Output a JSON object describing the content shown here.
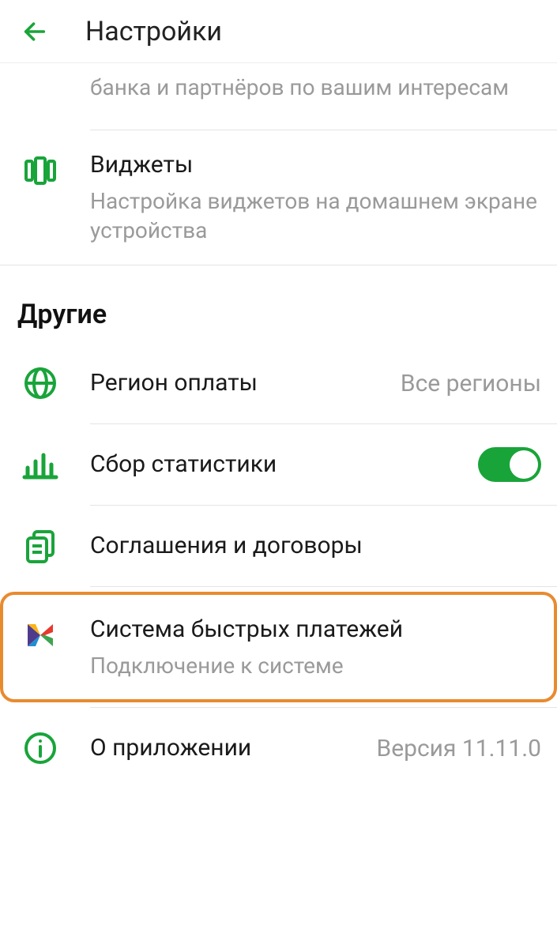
{
  "header": {
    "title": "Настройки"
  },
  "items": {
    "partial": {
      "subtitle": "банка и партнёров по вашим интересам"
    },
    "widgets": {
      "title": "Виджеты",
      "subtitle": "Настройка виджетов на домашнем экране устройства"
    }
  },
  "section_other": "Другие",
  "other": {
    "region": {
      "title": "Регион оплаты",
      "value": "Все регионы"
    },
    "stats": {
      "title": "Сбор статистики",
      "enabled": true
    },
    "agreements": {
      "title": "Соглашения и договоры"
    },
    "sbp": {
      "title": "Система быстрых платежей",
      "subtitle": "Подключение к системе"
    },
    "about": {
      "title": "О приложении",
      "value": "Версия 11.11.0"
    }
  }
}
